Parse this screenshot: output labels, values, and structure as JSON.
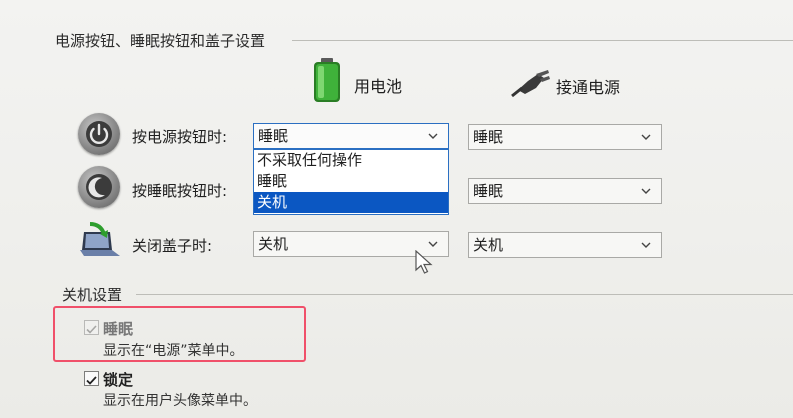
{
  "power_section": {
    "title": "电源按钮、睡眠按钮和盖子设置",
    "columns": {
      "battery": "用电池",
      "plugged_in": "接通电源"
    },
    "rows": [
      {
        "label": "按电源按钮时:",
        "battery_value": "睡眠",
        "plugged_value": "睡眠"
      },
      {
        "label": "按睡眠按钮时:",
        "battery_value": "睡眠",
        "plugged_value": "睡眠"
      },
      {
        "label": "关闭盖子时:",
        "battery_value": "关机",
        "plugged_value": "关机"
      }
    ],
    "dropdown_options": [
      "不采取任何操作",
      "睡眠",
      "关机"
    ],
    "dropdown_selected_index": 2
  },
  "shutdown_section": {
    "title": "关机设置",
    "items": [
      {
        "label": "睡眠",
        "description": "显示在“电源”菜单中。",
        "checked": true,
        "enabled": false
      },
      {
        "label": "锁定",
        "description": "显示在用户头像菜单中。",
        "checked": true,
        "enabled": true
      }
    ]
  },
  "colors": {
    "accent": "#0b57c2",
    "highlight": "#f0506a",
    "battery_green": "#3fb23a"
  },
  "icons": {
    "battery": "battery-icon",
    "plug": "power-plug-icon",
    "power_button": "power-button-icon",
    "sleep_button": "sleep-button-icon",
    "lid": "laptop-lid-icon",
    "chevron": "chevron-down-icon",
    "cursor": "mouse-cursor-icon"
  }
}
